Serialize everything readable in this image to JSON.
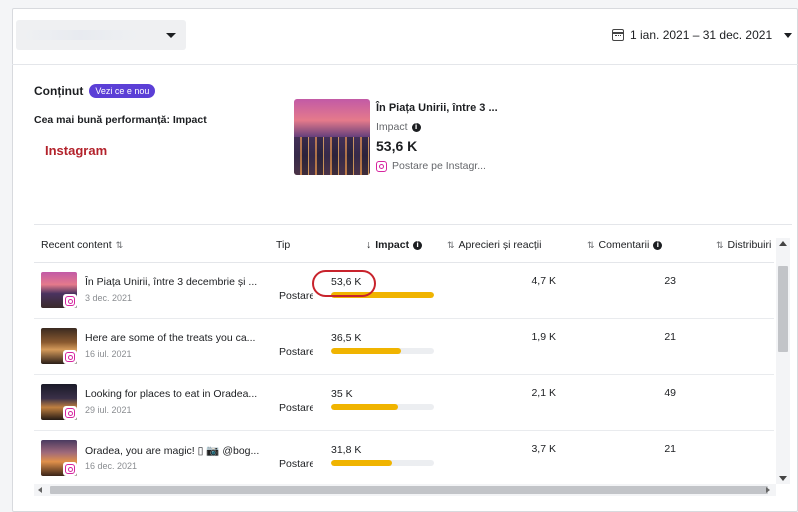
{
  "header": {
    "date_range": "1 ian. 2021 – 31 dec. 2021"
  },
  "content": {
    "title": "Conținut",
    "badge": "Vezi ce e nou",
    "best_performance": "Cea mai bună performanță: Impact",
    "platform": "Instagram",
    "featured": {
      "title": "În Piața Unirii, între 3 ...",
      "metric_label": "Impact",
      "value": "53,6 K",
      "source": "Postare pe Instagr..."
    }
  },
  "table": {
    "headers": {
      "recent": "Recent content",
      "type": "Tip",
      "impact": "Impact",
      "likes": "Aprecieri și reacții",
      "comments": "Comentarii",
      "distribution": "Distribuiri"
    },
    "rows": [
      {
        "title": "În Piața Unirii, între 3 decembrie și ...",
        "date": "3 dec. 2021",
        "type": "Postare",
        "impact": "53,6 K",
        "impact_fraction": 1.0,
        "likes": "4,7 K",
        "comments": "23"
      },
      {
        "title": "Here are some of the treats you ca...",
        "date": "16 iul. 2021",
        "type": "Postare",
        "impact": "36,5 K",
        "impact_fraction": 0.68,
        "likes": "1,9 K",
        "comments": "21"
      },
      {
        "title": "Looking for places to eat in Oradea...",
        "date": "29 iul. 2021",
        "type": "Postare",
        "impact": "35 K",
        "impact_fraction": 0.65,
        "likes": "2,1 K",
        "comments": "49"
      },
      {
        "title": "Oradea, you are magic! ▯ 📷 @bog...",
        "date": "16 dec. 2021",
        "type": "Postare",
        "impact": "31,8 K",
        "impact_fraction": 0.59,
        "likes": "3,7 K",
        "comments": "21"
      }
    ]
  },
  "colors": {
    "badge": "#5b3fd6",
    "instagram_label": "#b3222b",
    "bar_fill": "#f0b400",
    "highlight_ring": "#c8232c"
  },
  "icons": {
    "calendar": "calendar-icon",
    "info": "info-icon",
    "instagram": "instagram-icon",
    "sort": "sort-icon"
  }
}
